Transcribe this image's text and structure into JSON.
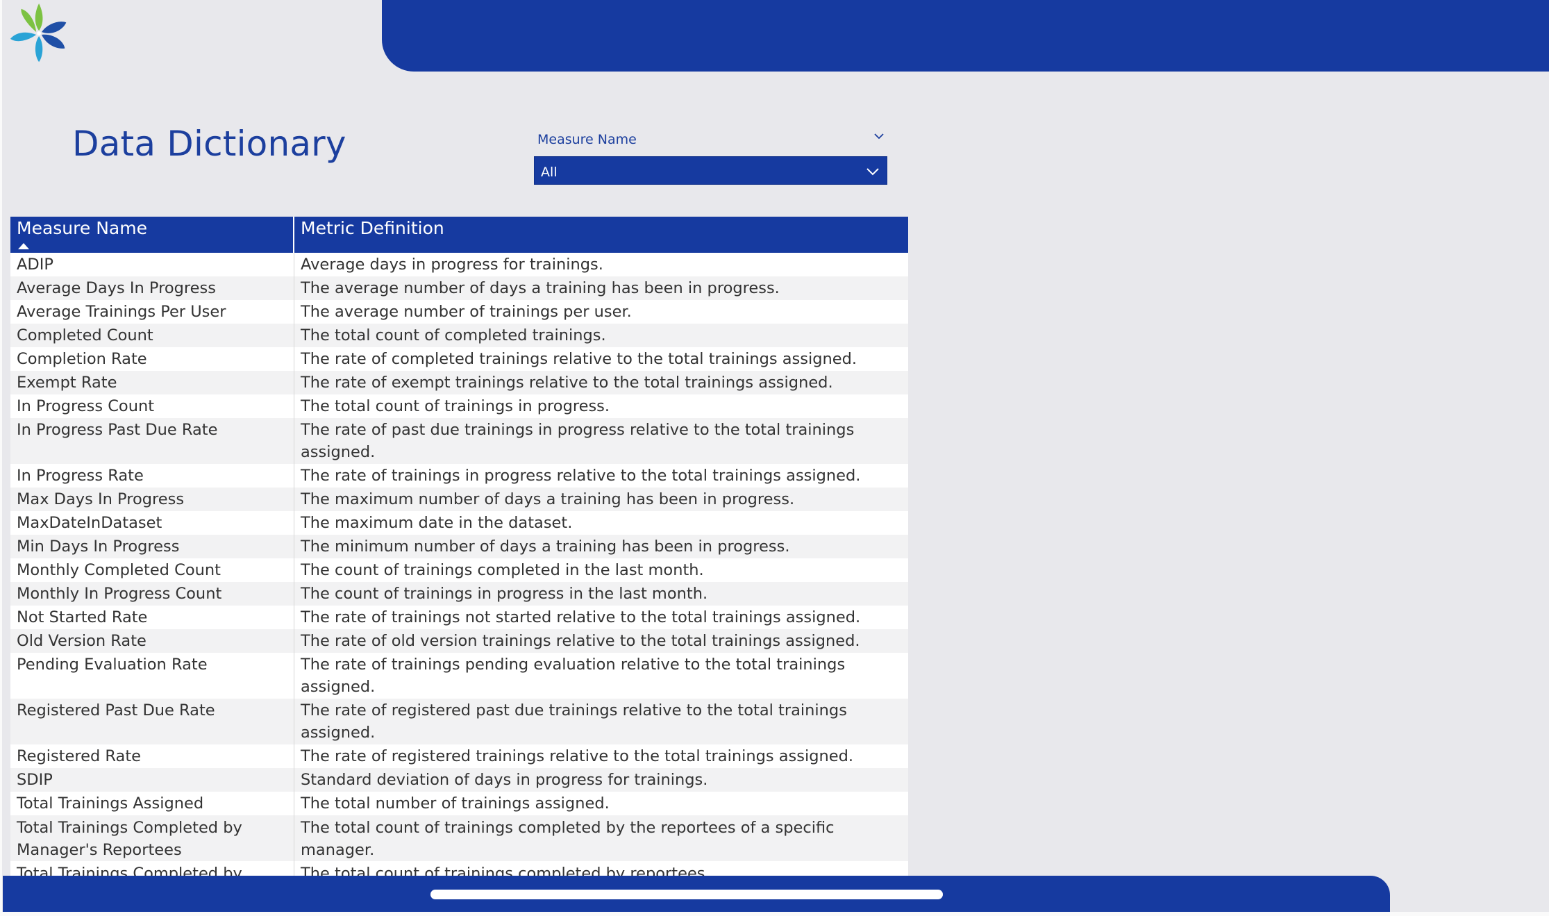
{
  "header": {
    "title": "Data Dictionary"
  },
  "slicer": {
    "label": "Measure Name",
    "value": "All"
  },
  "table": {
    "columns": [
      "Measure Name",
      "Metric Definition"
    ],
    "sort_column": "Measure Name",
    "rows": [
      [
        "ADIP",
        "Average days in progress for trainings."
      ],
      [
        "Average Days In Progress",
        "The average number of days a training has been in progress."
      ],
      [
        "Average Trainings Per User",
        "The average number of trainings per user."
      ],
      [
        "Completed Count",
        "The total count of completed trainings."
      ],
      [
        "Completion Rate",
        "The rate of completed trainings relative to the total trainings assigned."
      ],
      [
        "Exempt Rate",
        "The rate of exempt trainings relative to the total trainings assigned."
      ],
      [
        "In Progress Count",
        "The total count of trainings in progress."
      ],
      [
        "In Progress Past Due Rate",
        "The rate of past due trainings in progress relative to the total trainings assigned."
      ],
      [
        "In Progress Rate",
        "The rate of trainings in progress relative to the total trainings assigned."
      ],
      [
        "Max Days In Progress",
        "The maximum number of days a training has been in progress."
      ],
      [
        "MaxDateInDataset",
        "The maximum date in the dataset."
      ],
      [
        "Min Days In Progress",
        "The minimum number of days a training has been in progress."
      ],
      [
        "Monthly Completed Count",
        "The count of trainings completed in the last month."
      ],
      [
        "Monthly In Progress Count",
        "The count of trainings in progress in the last month."
      ],
      [
        "Not Started Rate",
        "The rate of trainings not started relative to the total trainings assigned."
      ],
      [
        "Old Version Rate",
        "The rate of old version trainings relative to the total trainings assigned."
      ],
      [
        "Pending Evaluation Rate",
        "The rate of trainings pending evaluation relative to the total trainings assigned."
      ],
      [
        "Registered Past Due Rate",
        "The rate of registered past due trainings relative to the total trainings assigned."
      ],
      [
        "Registered Rate",
        "The rate of registered trainings relative to the total trainings assigned."
      ],
      [
        "SDIP",
        "Standard deviation of days in progress for trainings."
      ],
      [
        "Total Trainings Assigned",
        "The total number of trainings assigned."
      ],
      [
        "Total Trainings Completed by Manager's Reportees",
        "The total count of trainings completed by the reportees of a specific manager."
      ],
      [
        "Total Trainings Completed by Reportees",
        "The total count of trainings completed by reportees."
      ]
    ]
  },
  "colors": {
    "brand_blue": "#163aa0",
    "background": "#e8e8ec"
  }
}
